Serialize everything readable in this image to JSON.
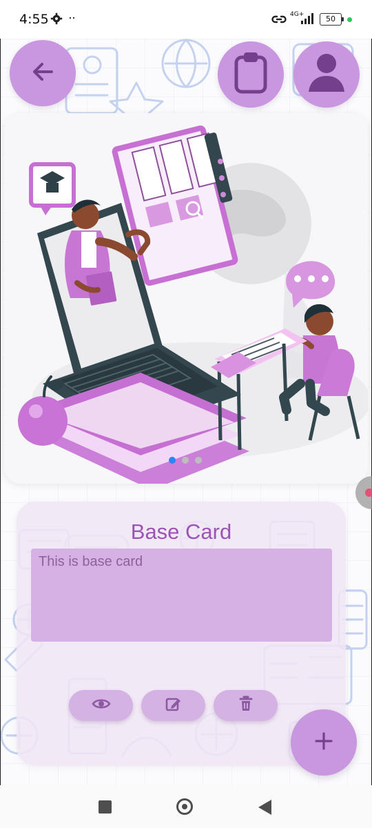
{
  "status_bar": {
    "time": "4:55",
    "extra_indicator": "··",
    "network_label": "4G+",
    "battery": "50"
  },
  "top_bar": {
    "back_icon": "back-arrow-icon",
    "clipboard_icon": "clipboard-icon",
    "profile_icon": "person-icon"
  },
  "carousel": {
    "illustration": "online-teacher-laptop-student",
    "page_count": 3,
    "active_page": 1
  },
  "card": {
    "title": "Base Card",
    "text": "This is base card",
    "actions": [
      {
        "icon": "eye-icon"
      },
      {
        "icon": "edit-icon"
      },
      {
        "icon": "trash-icon"
      }
    ]
  },
  "fab": {
    "icon": "plus-icon"
  },
  "navigation": {
    "recent_icon": "square-icon",
    "home_icon": "circle-icon",
    "back_icon": "triangle-back-icon"
  },
  "colors": {
    "accent": "#C996E0",
    "card_title": "#9B54B3",
    "card_input": "#D5B2E3",
    "active_dot": "#2F83F4"
  }
}
